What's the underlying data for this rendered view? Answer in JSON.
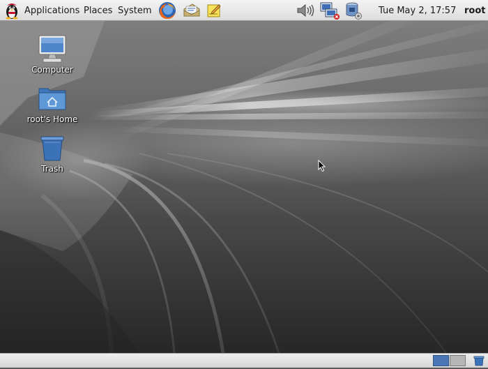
{
  "top_panel": {
    "menus": [
      "Applications",
      "Places",
      "System"
    ],
    "launchers": [
      "firefox-icon",
      "mail-icon",
      "notes-icon"
    ],
    "tray": [
      "volume-icon",
      "network-icon",
      "updates-icon"
    ],
    "clock": "Tue May  2, 17:57",
    "user": "root"
  },
  "desktop": {
    "icons": [
      {
        "label": "Computer"
      },
      {
        "label": "root's Home"
      },
      {
        "label": "Trash"
      }
    ]
  },
  "bottom_panel": {
    "workspaces": 2,
    "active_workspace": 1
  },
  "colors": {
    "panel": "#e4e4e4",
    "folder_blue": "#4a86c8",
    "workspace_active": "#4a76b5"
  }
}
